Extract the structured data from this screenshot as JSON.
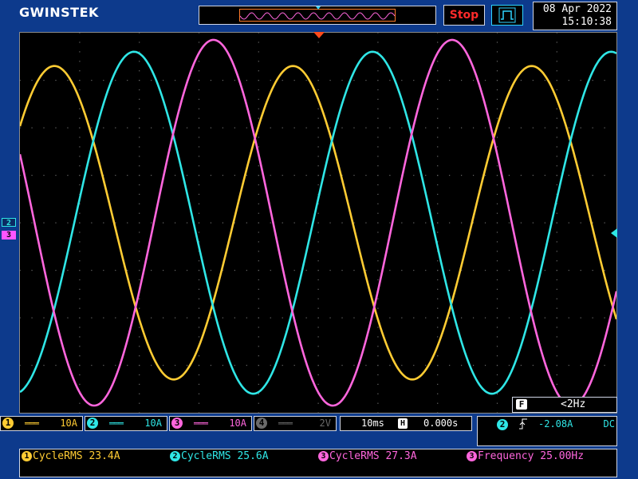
{
  "header": {
    "brand": "GWINSTEK",
    "run_state": "Stop",
    "acquire_icon": "pulse-icon",
    "date": "08 Apr 2022",
    "time": "15:10:38"
  },
  "colors": {
    "ch1": "#ffcc33",
    "ch2": "#2fe6e6",
    "ch3": "#ff66dd",
    "ch4": "#6a6a6a",
    "stop": "#ff2a2a",
    "memory_window": "#ff7a2a",
    "trigger_marker": "#ff4a1a"
  },
  "screen_markers": {
    "ch2_label": "2",
    "ch3_label": "3"
  },
  "trigger_frequency": {
    "label": "F",
    "value": "<2Hz"
  },
  "channels": [
    {
      "num": "1",
      "coupling": "DC",
      "scale": "10A",
      "enabled": true
    },
    {
      "num": "2",
      "coupling": "DC",
      "scale": "10A",
      "enabled": true
    },
    {
      "num": "3",
      "coupling": "DC",
      "scale": "10A",
      "enabled": true
    },
    {
      "num": "4",
      "coupling": "DC",
      "scale": "2V",
      "enabled": false
    }
  ],
  "timebase": {
    "scale": "10ms",
    "h_icon": "H",
    "position": "0.000s"
  },
  "trigger": {
    "source": "2",
    "slope_icon": "rising-edge-icon",
    "level": "-2.08A",
    "coupling": "DC"
  },
  "measurements": [
    {
      "num": "1",
      "label": "CycleRMS",
      "value": "23.4A"
    },
    {
      "num": "2",
      "label": "CycleRMS",
      "value": "25.6A"
    },
    {
      "num": "3",
      "label": "CycleRMS",
      "value": "27.3A"
    },
    {
      "num": "3",
      "label": "Frequency",
      "value": "25.00Hz"
    }
  ],
  "chart_data": {
    "type": "line",
    "x_label": "",
    "y_label": "",
    "x_range_ms": [
      -50,
      50
    ],
    "y_range_A": [
      -40,
      40
    ],
    "grid": true,
    "series": [
      {
        "channel": "1",
        "color": "#ffcc33",
        "amplitude_A": 33,
        "frequency_Hz": 25,
        "phase_deg": 128,
        "offset_A": 0
      },
      {
        "channel": "2",
        "color": "#2fe6e6",
        "amplitude_A": 36,
        "frequency_Hz": 25,
        "phase_deg": 8,
        "offset_A": 0
      },
      {
        "channel": "3",
        "color": "#ff66dd",
        "amplitude_A": 38.5,
        "frequency_Hz": 25,
        "phase_deg": 248,
        "offset_A": 0
      }
    ]
  }
}
